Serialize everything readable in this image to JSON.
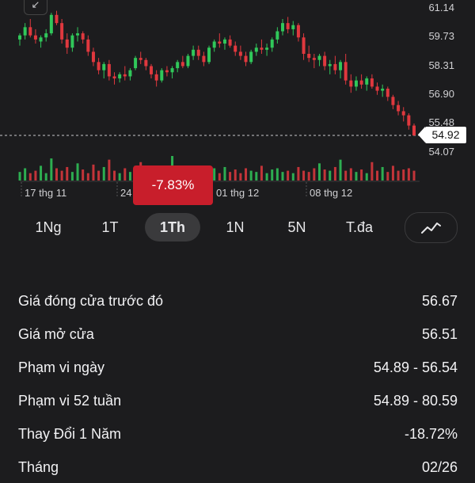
{
  "chart_data": {
    "type": "candlestick",
    "y_ticks": [
      "61.14",
      "59.73",
      "58.31",
      "56.90",
      "55.48",
      "54.07"
    ],
    "x_labels": [
      "17 thg 11",
      "24",
      "01 thg 12",
      "08 thg 12"
    ],
    "current_price": "54.92",
    "ylim": [
      54.07,
      61.14
    ],
    "up_color": "#30c85a",
    "down_color": "#e0383e",
    "candles": [
      [
        59.6,
        59.9,
        59.3,
        59.8
      ],
      [
        59.8,
        60.4,
        59.6,
        60.2
      ],
      [
        60.2,
        60.6,
        59.7,
        59.8
      ],
      [
        59.8,
        60.1,
        59.4,
        59.6
      ],
      [
        59.5,
        59.8,
        59.2,
        59.7
      ],
      [
        59.7,
        60.1,
        59.5,
        59.9
      ],
      [
        59.9,
        60.9,
        59.8,
        60.8
      ],
      [
        60.8,
        61.0,
        60.3,
        60.4
      ],
      [
        60.4,
        60.6,
        59.4,
        59.6
      ],
      [
        59.6,
        59.9,
        58.9,
        59.2
      ],
      [
        59.2,
        59.9,
        59.0,
        59.8
      ],
      [
        59.8,
        60.2,
        59.5,
        59.9
      ],
      [
        59.9,
        60.0,
        59.4,
        59.6
      ],
      [
        59.6,
        59.8,
        58.8,
        59.0
      ],
      [
        59.0,
        59.2,
        58.3,
        58.5
      ],
      [
        58.5,
        58.7,
        57.9,
        58.1
      ],
      [
        58.1,
        58.5,
        57.7,
        58.4
      ],
      [
        58.4,
        58.6,
        57.6,
        57.8
      ],
      [
        57.8,
        58.0,
        57.4,
        57.7
      ],
      [
        57.7,
        58.0,
        57.5,
        57.9
      ],
      [
        57.9,
        58.3,
        57.6,
        57.8
      ],
      [
        57.8,
        58.2,
        57.6,
        58.1
      ],
      [
        58.2,
        58.8,
        58.1,
        58.7
      ],
      [
        58.7,
        59.0,
        58.4,
        58.6
      ],
      [
        58.6,
        58.7,
        58.1,
        58.3
      ],
      [
        58.3,
        58.4,
        57.7,
        57.9
      ],
      [
        57.9,
        58.1,
        57.3,
        57.6
      ],
      [
        57.6,
        58.2,
        57.5,
        58.1
      ],
      [
        58.1,
        58.3,
        57.8,
        58.0
      ],
      [
        58.0,
        58.3,
        57.7,
        58.2
      ],
      [
        58.2,
        58.6,
        58.0,
        58.5
      ],
      [
        58.5,
        58.8,
        58.2,
        58.3
      ],
      [
        58.3,
        58.9,
        58.2,
        58.8
      ],
      [
        58.8,
        59.3,
        58.6,
        59.1
      ],
      [
        59.1,
        59.3,
        58.6,
        58.8
      ],
      [
        58.8,
        59.0,
        58.3,
        58.5
      ],
      [
        58.5,
        59.3,
        58.4,
        59.2
      ],
      [
        59.2,
        59.6,
        59.0,
        59.5
      ],
      [
        59.5,
        59.9,
        59.2,
        59.4
      ],
      [
        59.4,
        59.7,
        59.1,
        59.6
      ],
      [
        59.6,
        59.8,
        59.2,
        59.3
      ],
      [
        59.3,
        59.5,
        58.8,
        59.0
      ],
      [
        59.0,
        59.3,
        58.6,
        58.8
      ],
      [
        58.8,
        59.0,
        58.3,
        58.5
      ],
      [
        58.5,
        59.1,
        58.4,
        59.0
      ],
      [
        59.0,
        59.4,
        58.8,
        59.2
      ],
      [
        59.2,
        59.6,
        58.9,
        59.1
      ],
      [
        59.1,
        59.4,
        58.8,
        59.2
      ],
      [
        59.2,
        59.7,
        59.0,
        59.6
      ],
      [
        59.6,
        60.2,
        59.4,
        60.0
      ],
      [
        60.0,
        60.6,
        59.8,
        60.4
      ],
      [
        60.4,
        60.7,
        59.9,
        60.1
      ],
      [
        60.1,
        60.5,
        59.8,
        60.3
      ],
      [
        60.3,
        60.4,
        59.5,
        59.7
      ],
      [
        59.7,
        59.9,
        58.6,
        58.9
      ],
      [
        58.9,
        59.3,
        58.5,
        58.7
      ],
      [
        58.7,
        58.9,
        58.2,
        58.6
      ],
      [
        58.6,
        58.9,
        58.3,
        58.8
      ],
      [
        58.8,
        59.0,
        58.1,
        58.3
      ],
      [
        58.3,
        58.6,
        57.9,
        58.4
      ],
      [
        58.4,
        58.8,
        57.9,
        58.1
      ],
      [
        58.1,
        58.6,
        57.7,
        58.5
      ],
      [
        58.5,
        58.9,
        57.4,
        57.6
      ],
      [
        57.6,
        57.9,
        57.0,
        57.3
      ],
      [
        57.3,
        57.8,
        57.1,
        57.6
      ],
      [
        57.6,
        57.9,
        57.2,
        57.4
      ],
      [
        57.4,
        57.8,
        57.1,
        57.7
      ],
      [
        57.7,
        57.9,
        57.2,
        57.3
      ],
      [
        57.3,
        57.5,
        56.9,
        57.1
      ],
      [
        57.1,
        57.4,
        56.8,
        57.2
      ],
      [
        57.2,
        57.3,
        56.6,
        56.8
      ],
      [
        56.8,
        56.9,
        56.2,
        56.4
      ],
      [
        56.4,
        56.6,
        55.9,
        56.1
      ],
      [
        56.1,
        56.3,
        55.6,
        55.9
      ],
      [
        55.9,
        56.0,
        55.2,
        55.4
      ],
      [
        55.4,
        55.5,
        54.9,
        54.92
      ]
    ],
    "volumes": [
      0.35,
      0.5,
      0.3,
      0.4,
      0.6,
      0.3,
      0.9,
      0.5,
      0.4,
      0.55,
      0.35,
      0.7,
      0.45,
      0.3,
      0.65,
      0.4,
      0.55,
      0.85,
      0.4,
      0.3,
      0.5,
      0.35,
      0.6,
      0.75,
      0.4,
      0.45,
      0.35,
      0.5,
      0.3,
      1.0,
      0.4,
      0.55,
      0.35,
      0.3,
      0.45,
      0.6,
      0.4,
      0.5,
      0.3,
      0.55,
      0.35,
      0.45,
      0.3,
      0.5,
      0.4,
      0.35,
      0.6,
      0.3,
      0.45,
      0.5,
      0.35,
      0.4,
      0.3,
      0.55,
      0.4,
      0.35,
      0.5,
      0.7,
      0.45,
      0.4,
      0.55,
      0.85,
      0.4,
      0.5,
      0.35,
      0.45,
      0.3,
      0.75,
      0.4,
      0.55,
      0.35,
      0.6,
      0.4,
      0.45,
      0.5,
      0.4
    ]
  },
  "nav": {
    "back_icon": "↙"
  },
  "tooltip": {
    "change": "-7.83%"
  },
  "range_tabs": [
    "1Ng",
    "1T",
    "1Th",
    "1N",
    "5N",
    "T.đa"
  ],
  "active_tab": "1Th",
  "chart_type_icon": "line-chart-icon",
  "stats": [
    {
      "label": "Giá đóng cửa trước đó",
      "value": "56.67"
    },
    {
      "label": "Giá mở cửa",
      "value": "56.51"
    },
    {
      "label": "Phạm vi ngày",
      "value": "54.89 - 56.54"
    },
    {
      "label": "Phạm vi 52 tuần",
      "value": "54.89 - 80.59"
    },
    {
      "label": "Thay Đổi 1 Năm",
      "value": "-18.72%"
    },
    {
      "label": "Tháng",
      "value": "02/26"
    }
  ]
}
